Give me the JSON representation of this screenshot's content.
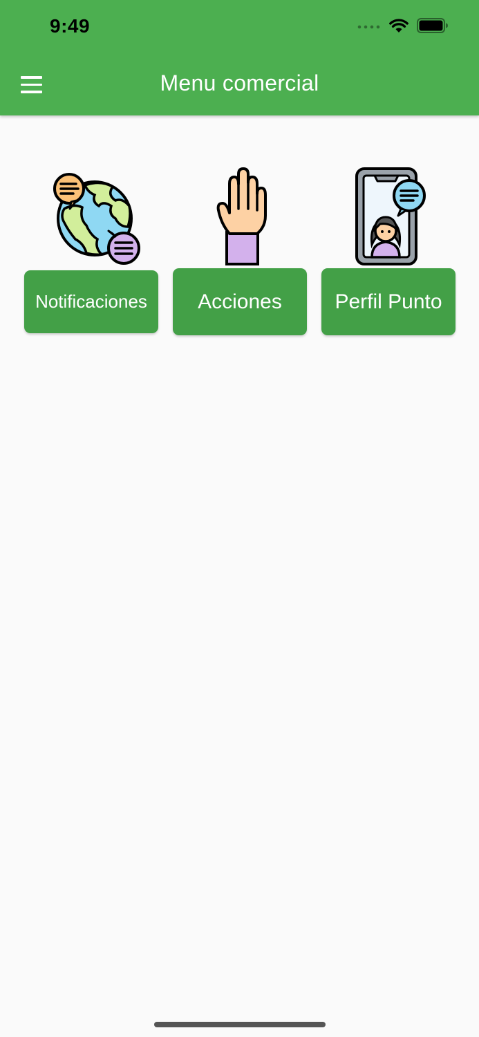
{
  "status_bar": {
    "time": "9:49"
  },
  "app_bar": {
    "title": "Menu comercial",
    "menu_icon": "hamburger-menu-icon"
  },
  "menu_items": [
    {
      "label": "Notificaciones",
      "icon": "globe-chat-icon"
    },
    {
      "label": "Acciones",
      "icon": "raised-hand-icon"
    },
    {
      "label": "Perfil Punto",
      "icon": "phone-profile-icon"
    }
  ],
  "colors": {
    "app_bar": "#4caf50",
    "button": "#43a047",
    "background": "#fafafa"
  }
}
